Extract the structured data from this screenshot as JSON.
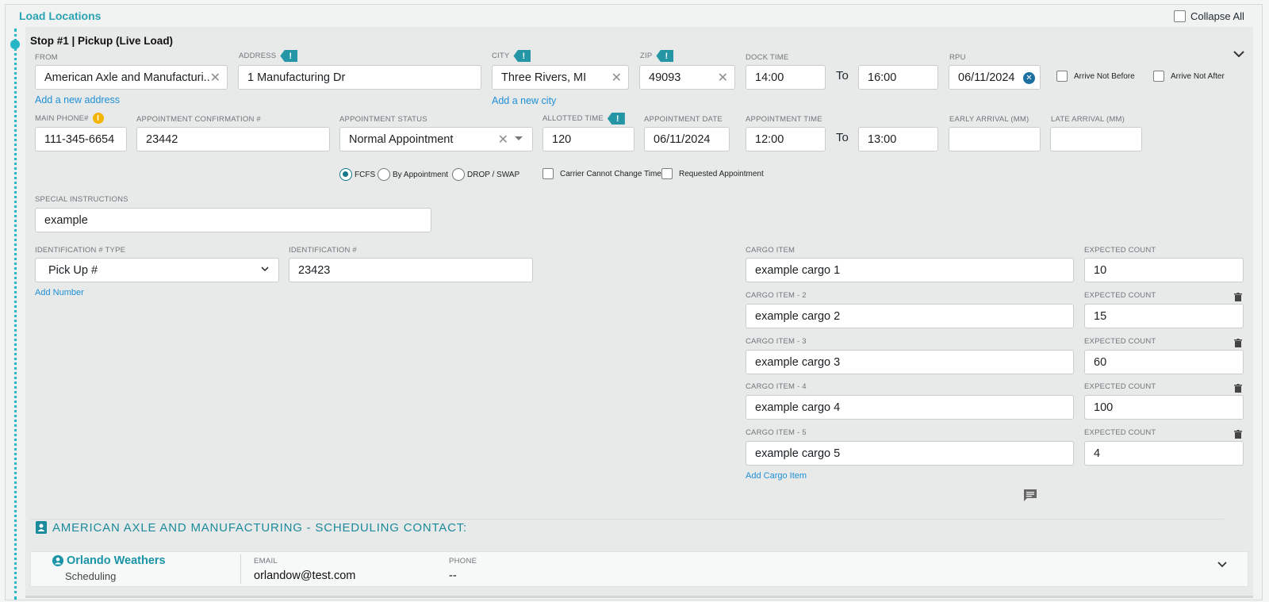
{
  "section": {
    "title": "Load Locations",
    "collapse_all": "Collapse All"
  },
  "stop": {
    "title": "Stop #1 | Pickup (Live Load)"
  },
  "from": {
    "label": "FROM",
    "value": "American Axle and Manufacturi..",
    "link": "Add a new address"
  },
  "address": {
    "label": "ADDRESS",
    "value": "1 Manufacturing Dr"
  },
  "city": {
    "label": "CITY",
    "value": "Three Rivers, MI",
    "link": "Add a new city"
  },
  "zip": {
    "label": "ZIP",
    "value": "49093"
  },
  "dock_time": {
    "label": "DOCK TIME",
    "from": "14:00",
    "to_label": "To",
    "to": "16:00"
  },
  "rpu": {
    "label": "RPU",
    "value": "06/11/2024"
  },
  "arrive_not_before": "Arrive Not Before",
  "arrive_not_after": "Arrive Not After",
  "main_phone": {
    "label": "MAIN PHONE#",
    "value": "111-345-6654"
  },
  "appt_conf": {
    "label": "APPOINTMENT CONFIRMATION #",
    "value": "23442"
  },
  "appt_status": {
    "label": "APPOINTMENT STATUS",
    "value": "Normal Appointment"
  },
  "allotted_time": {
    "label": "ALLOTTED TIME",
    "value": "120"
  },
  "appt_date": {
    "label": "APPOINTMENT DATE",
    "value": "06/11/2024"
  },
  "appt_time": {
    "label": "APPOINTMENT TIME",
    "from": "12:00",
    "to_label": "To",
    "to": "13:00"
  },
  "early_arrival": {
    "label": "EARLY ARRIVAL (MM)",
    "value": ""
  },
  "late_arrival": {
    "label": "LATE ARRIVAL (MM)",
    "value": ""
  },
  "appt_type_options": [
    "FCFS",
    "By Appointment",
    "DROP / SWAP"
  ],
  "carrier_cannot_change": "Carrier Cannot Change Time",
  "requested_appointment": "Requested Appointment",
  "special_instructions": {
    "label": "SPECIAL INSTRUCTIONS",
    "value": "example"
  },
  "identification": {
    "type_label": "IDENTIFICATION # TYPE",
    "type_value": "Pick Up #",
    "number_label": "IDENTIFICATION #",
    "number_value": "23423",
    "add_link": "Add Number"
  },
  "cargo": {
    "items": [
      {
        "label": "CARGO ITEM",
        "value": "example cargo 1",
        "count_label": "EXPECTED COUNT",
        "count": "10"
      },
      {
        "label": "CARGO ITEM - 2",
        "value": "example cargo 2",
        "count_label": "EXPECTED COUNT",
        "count": "15"
      },
      {
        "label": "CARGO ITEM - 3",
        "value": "example cargo 3",
        "count_label": "EXPECTED COUNT",
        "count": "60"
      },
      {
        "label": "CARGO ITEM - 4",
        "value": "example cargo 4",
        "count_label": "EXPECTED COUNT",
        "count": "100"
      },
      {
        "label": "CARGO ITEM - 5",
        "value": "example cargo 5",
        "count_label": "EXPECTED COUNT",
        "count": "4"
      }
    ],
    "add_link": "Add Cargo Item"
  },
  "contact": {
    "header": "AMERICAN AXLE AND MANUFACTURING - SCHEDULING CONTACT:",
    "name": "Orlando Weathers",
    "role": "Scheduling",
    "email_label": "EMAIL",
    "email": "orlandow@test.com",
    "phone_label": "PHONE",
    "phone": "--"
  },
  "colors": {
    "accent": "#2aa3b3",
    "link": "#1f8fd6",
    "flag": "#2596a6",
    "info": "#f5b400"
  },
  "icons": {
    "flag": "exclamation-flag-icon",
    "info": "info-icon",
    "clear": "close-icon",
    "trash": "trash-icon",
    "contact": "contact-book-icon",
    "user": "user-circle-icon",
    "message": "message-icon",
    "chevron": "chevron-down-icon"
  }
}
